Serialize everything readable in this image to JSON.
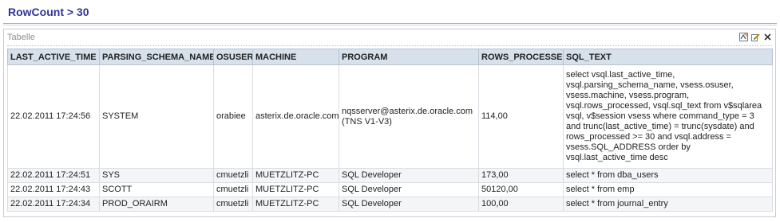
{
  "header": {
    "title": "RowCount > 30"
  },
  "panel": {
    "label": "Tabelle",
    "tools": [
      {
        "name": "export-icon"
      },
      {
        "name": "edit-icon"
      },
      {
        "name": "close-icon"
      }
    ]
  },
  "table": {
    "columns": [
      "LAST_ACTIVE_TIME",
      "PARSING_SCHEMA_NAME",
      "OSUSER",
      "MACHINE",
      "PROGRAM",
      "ROWS_PROCESSED",
      "SQL_TEXT"
    ],
    "rows": [
      {
        "last_active_time": "22.02.2011 17:24:56",
        "parsing_schema_name": "SYSTEM",
        "osuser": "orabiee",
        "machine": "asterix.de.oracle.com",
        "program": "nqsserver@asterix.de.oracle.com (TNS V1-V3)",
        "rows_processed": "114,00",
        "sql_text": "select vsql.last_active_time, vsql.parsing_schema_name, vsess.osuser, vsess.machine, vsess.program, vsql.rows_processed, vsql.sql_text from v$sqlarea vsql, v$session vsess where command_type = 3 and trunc(last_active_time) = trunc(sysdate) and rows_processed >= 30 and vsql.address = vsess.SQL_ADDRESS order by vsql.last_active_time desc"
      },
      {
        "last_active_time": "22.02.2011 17:24:51",
        "parsing_schema_name": "SYS",
        "osuser": "cmuetzli",
        "machine": "MUETZLITZ-PC",
        "program": "SQL Developer",
        "rows_processed": "173,00",
        "sql_text": "select * from dba_users"
      },
      {
        "last_active_time": "22.02.2011 17:24:43",
        "parsing_schema_name": "SCOTT",
        "osuser": "cmuetzli",
        "machine": "MUETZLITZ-PC",
        "program": "SQL Developer",
        "rows_processed": "50120,00",
        "sql_text": "select * from emp"
      },
      {
        "last_active_time": "22.02.2011 17:24:34",
        "parsing_schema_name": "PROD_ORAIRM",
        "osuser": "cmuetzli",
        "machine": "MUETZLITZ-PC",
        "program": "SQL Developer",
        "rows_processed": "100,00",
        "sql_text": "select * from journal_entry"
      }
    ]
  },
  "colors": {
    "title": "#333399",
    "header_bg": "#d6e1ec",
    "rule": "#9fb6cd"
  }
}
